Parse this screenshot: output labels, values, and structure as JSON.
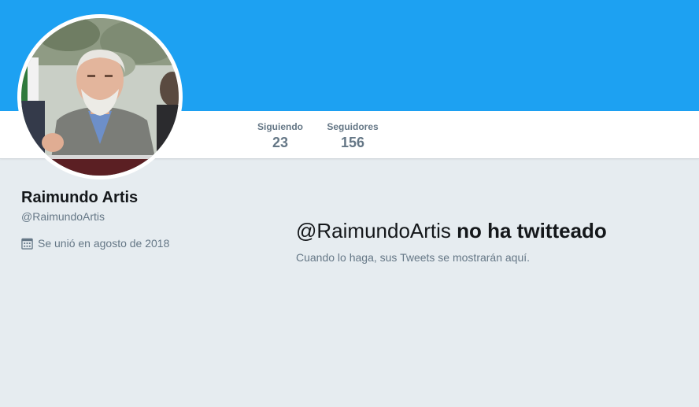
{
  "profile": {
    "name": "Raimundo Artis",
    "handle": "@RaimundoArtis",
    "joined": "Se unió en agosto de 2018",
    "joined_icon": "calendar-icon",
    "avatar_icon": "profile-photo"
  },
  "stats": {
    "following_label": "Siguiendo",
    "following_value": "23",
    "followers_label": "Seguidores",
    "followers_value": "156"
  },
  "timeline": {
    "empty_handle": "@RaimundoArtis",
    "empty_title_rest": " no ha twitteado",
    "empty_subtitle": "Cuando lo haga, sus Tweets se mostrarán aquí."
  },
  "colors": {
    "banner": "#1da1f2",
    "background": "#e6ecf0",
    "text_primary": "#14171a",
    "text_secondary": "#657786"
  }
}
